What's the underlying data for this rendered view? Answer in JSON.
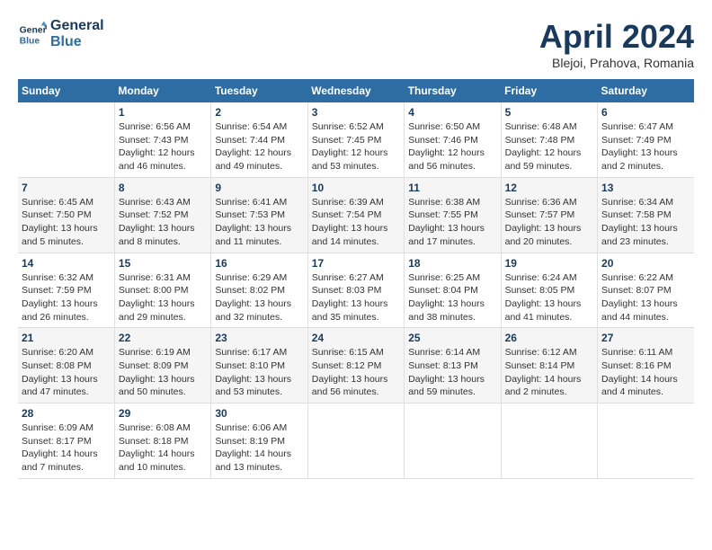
{
  "logo": {
    "line1": "General",
    "line2": "Blue"
  },
  "title": "April 2024",
  "subtitle": "Blejoi, Prahova, Romania",
  "weekdays": [
    "Sunday",
    "Monday",
    "Tuesday",
    "Wednesday",
    "Thursday",
    "Friday",
    "Saturday"
  ],
  "weeks": [
    [
      {
        "num": "",
        "info": ""
      },
      {
        "num": "1",
        "info": "Sunrise: 6:56 AM\nSunset: 7:43 PM\nDaylight: 12 hours\nand 46 minutes."
      },
      {
        "num": "2",
        "info": "Sunrise: 6:54 AM\nSunset: 7:44 PM\nDaylight: 12 hours\nand 49 minutes."
      },
      {
        "num": "3",
        "info": "Sunrise: 6:52 AM\nSunset: 7:45 PM\nDaylight: 12 hours\nand 53 minutes."
      },
      {
        "num": "4",
        "info": "Sunrise: 6:50 AM\nSunset: 7:46 PM\nDaylight: 12 hours\nand 56 minutes."
      },
      {
        "num": "5",
        "info": "Sunrise: 6:48 AM\nSunset: 7:48 PM\nDaylight: 12 hours\nand 59 minutes."
      },
      {
        "num": "6",
        "info": "Sunrise: 6:47 AM\nSunset: 7:49 PM\nDaylight: 13 hours\nand 2 minutes."
      }
    ],
    [
      {
        "num": "7",
        "info": "Sunrise: 6:45 AM\nSunset: 7:50 PM\nDaylight: 13 hours\nand 5 minutes."
      },
      {
        "num": "8",
        "info": "Sunrise: 6:43 AM\nSunset: 7:52 PM\nDaylight: 13 hours\nand 8 minutes."
      },
      {
        "num": "9",
        "info": "Sunrise: 6:41 AM\nSunset: 7:53 PM\nDaylight: 13 hours\nand 11 minutes."
      },
      {
        "num": "10",
        "info": "Sunrise: 6:39 AM\nSunset: 7:54 PM\nDaylight: 13 hours\nand 14 minutes."
      },
      {
        "num": "11",
        "info": "Sunrise: 6:38 AM\nSunset: 7:55 PM\nDaylight: 13 hours\nand 17 minutes."
      },
      {
        "num": "12",
        "info": "Sunrise: 6:36 AM\nSunset: 7:57 PM\nDaylight: 13 hours\nand 20 minutes."
      },
      {
        "num": "13",
        "info": "Sunrise: 6:34 AM\nSunset: 7:58 PM\nDaylight: 13 hours\nand 23 minutes."
      }
    ],
    [
      {
        "num": "14",
        "info": "Sunrise: 6:32 AM\nSunset: 7:59 PM\nDaylight: 13 hours\nand 26 minutes."
      },
      {
        "num": "15",
        "info": "Sunrise: 6:31 AM\nSunset: 8:00 PM\nDaylight: 13 hours\nand 29 minutes."
      },
      {
        "num": "16",
        "info": "Sunrise: 6:29 AM\nSunset: 8:02 PM\nDaylight: 13 hours\nand 32 minutes."
      },
      {
        "num": "17",
        "info": "Sunrise: 6:27 AM\nSunset: 8:03 PM\nDaylight: 13 hours\nand 35 minutes."
      },
      {
        "num": "18",
        "info": "Sunrise: 6:25 AM\nSunset: 8:04 PM\nDaylight: 13 hours\nand 38 minutes."
      },
      {
        "num": "19",
        "info": "Sunrise: 6:24 AM\nSunset: 8:05 PM\nDaylight: 13 hours\nand 41 minutes."
      },
      {
        "num": "20",
        "info": "Sunrise: 6:22 AM\nSunset: 8:07 PM\nDaylight: 13 hours\nand 44 minutes."
      }
    ],
    [
      {
        "num": "21",
        "info": "Sunrise: 6:20 AM\nSunset: 8:08 PM\nDaylight: 13 hours\nand 47 minutes."
      },
      {
        "num": "22",
        "info": "Sunrise: 6:19 AM\nSunset: 8:09 PM\nDaylight: 13 hours\nand 50 minutes."
      },
      {
        "num": "23",
        "info": "Sunrise: 6:17 AM\nSunset: 8:10 PM\nDaylight: 13 hours\nand 53 minutes."
      },
      {
        "num": "24",
        "info": "Sunrise: 6:15 AM\nSunset: 8:12 PM\nDaylight: 13 hours\nand 56 minutes."
      },
      {
        "num": "25",
        "info": "Sunrise: 6:14 AM\nSunset: 8:13 PM\nDaylight: 13 hours\nand 59 minutes."
      },
      {
        "num": "26",
        "info": "Sunrise: 6:12 AM\nSunset: 8:14 PM\nDaylight: 14 hours\nand 2 minutes."
      },
      {
        "num": "27",
        "info": "Sunrise: 6:11 AM\nSunset: 8:16 PM\nDaylight: 14 hours\nand 4 minutes."
      }
    ],
    [
      {
        "num": "28",
        "info": "Sunrise: 6:09 AM\nSunset: 8:17 PM\nDaylight: 14 hours\nand 7 minutes."
      },
      {
        "num": "29",
        "info": "Sunrise: 6:08 AM\nSunset: 8:18 PM\nDaylight: 14 hours\nand 10 minutes."
      },
      {
        "num": "30",
        "info": "Sunrise: 6:06 AM\nSunset: 8:19 PM\nDaylight: 14 hours\nand 13 minutes."
      },
      {
        "num": "",
        "info": ""
      },
      {
        "num": "",
        "info": ""
      },
      {
        "num": "",
        "info": ""
      },
      {
        "num": "",
        "info": ""
      }
    ]
  ]
}
